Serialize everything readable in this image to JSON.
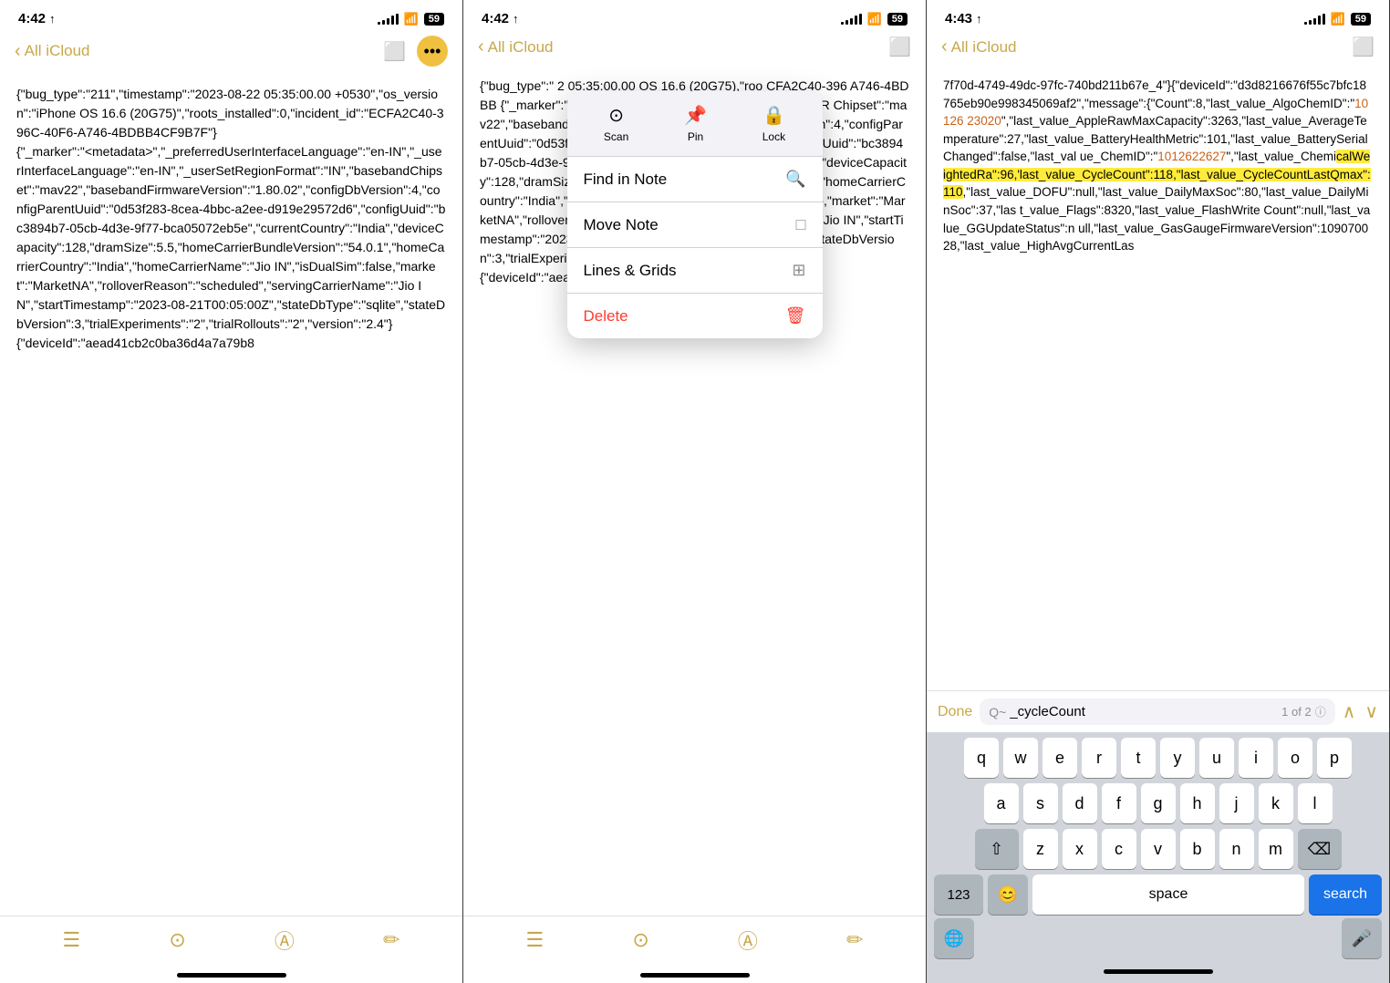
{
  "panels": [
    {
      "id": "panel1",
      "statusBar": {
        "time": "4:42",
        "locationIcon": "✈",
        "signalBars": [
          3,
          5,
          7,
          9,
          11
        ],
        "wifi": "WiFi",
        "battery": "59"
      },
      "navBar": {
        "backLabel": "All iCloud",
        "shareIcon": "⬜",
        "moreIcon": "•••"
      },
      "noteContent": "{\"bug_type\":\"211\",\"timestamp\":\"2023-08-22 05:35:00.00 +0530\",\"os_version\":\"iPhone OS 16.6 (20G75)\",\"roots_installed\":0,\"incident_id\":\"ECFA2C40-396C-40F6-A746-4BDBB4CF9B7F\"}\n{\"_marker\":\"<metadata>\",\"_preferredUserInterfaceLanguage\":\"en-IN\",\"_userInterfaceLanguage\":\"en-IN\",\"_userSetRegionFormat\":\"IN\",\"basebandChipset\":\"mav22\",\"basebandFirmwareVersion\":\"1.80.02\",\"configDbVersion\":4,\"configParentUuid\":\"0d53f283-8cea-4bbc-a2ee-d919e29572d6\",\"configUuid\":\"bc3894b7-05cb-4d3e-9f77-bca05072eb5e\",\"currentCountry\":\"India\",\"deviceCapacity\":128,\"dramSize\":5.5,\"homeCarrierBundleVersion\":\"54.0.1\",\"homeCarrierCountry\":\"India\",\"homeCarrierName\":\"Jio IN\",\"isDualSim\":false,\"market\":\"MarketNA\",\"rolloverReason\":\"scheduled\",\"servingCarrierName\":\"Jio IN\",\"startTimestamp\":\"2023-08-21T00:05:00Z\",\"stateDbType\":\"sqlite\",\"stateDbVersion\":3,\"trialExperiments\":\"2\",\"trialRollouts\":\"2\",\"version\":\"2.4\"}\n{\"deviceId\":\"aead41cb2c0ba36d4a7a79b8",
      "bottomIcons": [
        "⊟",
        "⊙",
        "Ⓐ",
        "✏"
      ]
    },
    {
      "id": "panel2",
      "statusBar": {
        "time": "4:42",
        "locationIcon": "✈",
        "signalBars": [
          3,
          5,
          7,
          9,
          11
        ],
        "wifi": "WiFi",
        "battery": "59"
      },
      "navBar": {
        "backLabel": "All iCloud",
        "shareIcon": "⬜"
      },
      "noteContentPartial": "{\"bug_type\":\" 2 05:35:00.00 OS 16.6 (20G75),\"roo CFA2C40-396 A746-4BDBB {\"_marker\":\"< terfaceLangu IN\",\"_userInter IN\",\"_userSetR Chipset\":\"mav22\",\"basebandFirmwareVersion\":\"1.80.02\",\"configDbVersion\":4,\"configParentUuid\":\"0d53f283-8cea-4bbc-a2ee-d919e29572d6\",\"configUuid\":\"bc3894b7-05cb-4d3e-9f77-bca05072eb5e\",\"currentCountry\":\"India\",\"deviceCapacity\":128,\"dramSize\":5.5,\"homeCarrierBundleVersion\":\"54.0.1\",\"homeCarrierCountry\":\"India\",\"homeCarrierName\":\"Jio IN\",\"isDualSim\":false,\"market\":\"MarketNA\",\"rolloverReason\":\"scheduled\",\"servingCarrierName\":\"Jio IN\",\"startTimestamp\":\"2023-08-21T00:05:00Z\",\"stateDbType\":\"sqlite\",\"stateDbVersion\":3,\"trialExperiments\":\"2\",\"trialRollouts\":\"2\",\"version\":\"2.4\"}\n{\"deviceId\":\"aead41cb2c0ba36d4a7a79b8",
      "contextMenu": {
        "topItems": [
          {
            "icon": "⊙",
            "label": "Scan"
          },
          {
            "icon": "📌",
            "label": "Pin"
          },
          {
            "icon": "🔒",
            "label": "Lock"
          }
        ],
        "items": [
          {
            "label": "Find in Note",
            "icon": "🔍",
            "isSearch": true
          },
          {
            "label": "Move Note",
            "icon": "□"
          },
          {
            "label": "Lines & Grids",
            "icon": "⊞"
          },
          {
            "label": "Delete",
            "icon": "🗑",
            "isDelete": true
          }
        ]
      },
      "bottomIcons": [
        "⊟",
        "⊙",
        "Ⓐ",
        "✏"
      ]
    },
    {
      "id": "panel3",
      "statusBar": {
        "time": "4:43",
        "locationIcon": "✈",
        "signalBars": [
          3,
          5,
          7,
          9,
          11
        ],
        "wifi": "WiFi",
        "battery": "59"
      },
      "navBar": {
        "backLabel": "All iCloud",
        "shareIcon": "⬜"
      },
      "noteContent": "7f70d-4749-49dc-97fc-740bd211b67e_4\"}{\"deviceId\":\"d3d8216676f55c7bfc18765eb90e998345069af2\",\"message\":{\"Count\":8,\"last_value_AlgoChemID\":\"10126 23020\",\"last_value_AppleRawMaxCapacity\":3263,\"last_value_AverageTemperature\":27,\"last_value_BatteryHealthMetric\":101,\"last_value_BatterySerialChanged\":false,\"last_value_ChemID\":\"1012622627\",\"last_value_ChemicalWeightedRa\":96,\"last_value_CycleCount\":118,\"last_value_CycleCountLastQmax\":110,\"last_value_DOFU\":null,\"last_value_DailyMaxSoc\":80,\"last_value_DailyMinSoc\":37,\"last_value_Flags\":8320,\"last_value_FlashWriteCount\":null,\"last_value_GGUpdateStatus\":null,\"last_value_GasGaugeFirmwareVersion\":109070028,\"last_value_HighAvgCurrentLas",
      "highlightedText1": "10126 23020",
      "highlightedText2": "last_value_CycleCount",
      "highlightedText2End": ":118,\"last_value_CycleCountLastQmax\":110",
      "orangeLink1": "10126 23020",
      "orangeLink2": "1012622627",
      "findBar": {
        "doneLabel": "Done",
        "searchIcon": "Q~",
        "searchValue": "_cycleCount",
        "countText": "1 of 2",
        "prevIcon": "∧",
        "nextIcon": "∨"
      },
      "keyboard": {
        "rows": [
          [
            "q",
            "w",
            "e",
            "r",
            "t",
            "y",
            "u",
            "i",
            "o",
            "p"
          ],
          [
            "a",
            "s",
            "d",
            "f",
            "g",
            "h",
            "j",
            "k",
            "l"
          ],
          [
            "z",
            "x",
            "c",
            "v",
            "b",
            "n",
            "m"
          ]
        ],
        "bottomRow": {
          "numbersLabel": "123",
          "emojiIcon": "😊",
          "spaceLabel": "space",
          "searchLabel": "search",
          "micIcon": "🎤"
        }
      }
    }
  ]
}
